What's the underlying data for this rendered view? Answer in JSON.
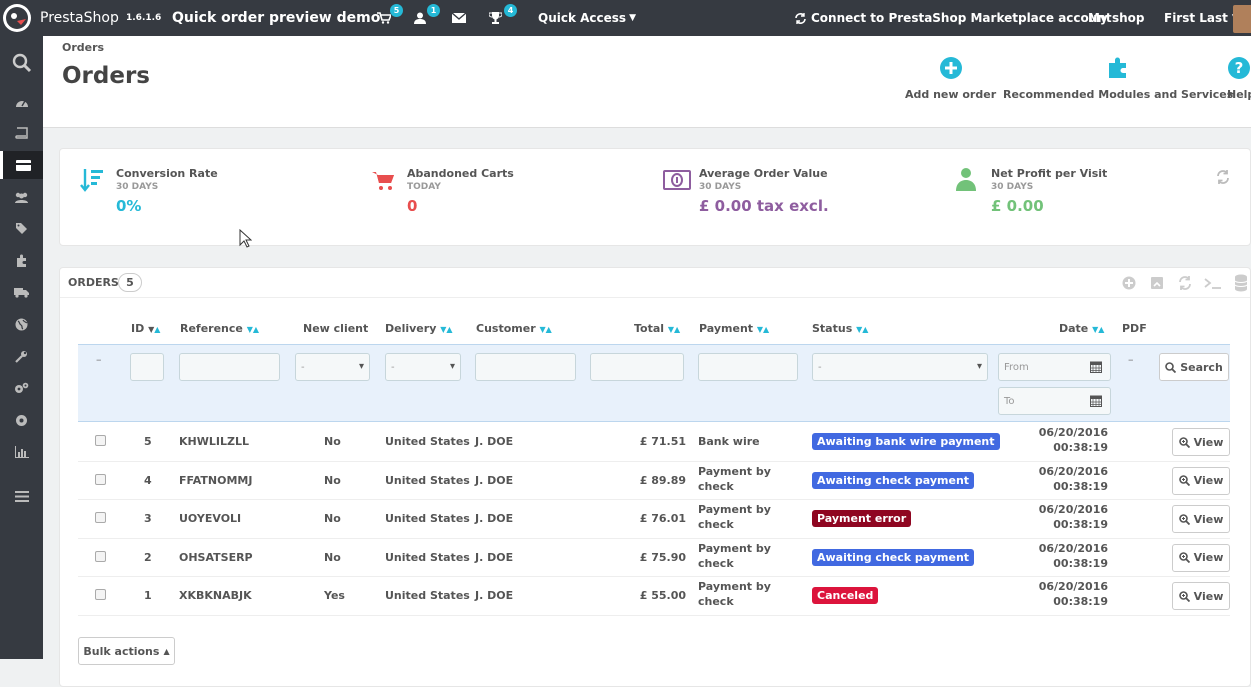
{
  "topbar": {
    "brand": "PrestaShop",
    "version": "1.6.1.6",
    "store_name": "Quick order preview demo",
    "cart_count": "5",
    "customer_count": "1",
    "trophy_count": "4",
    "quick_access": "Quick Access",
    "marketplace": "Connect to PrestaShop Marketplace account",
    "my_shop": "My shop",
    "user": "First Last"
  },
  "header": {
    "breadcrumb": "Orders",
    "title": "Orders",
    "toolbar": {
      "add_new": "Add new order",
      "recommended": "Recommended Modules and Services",
      "help": "Help"
    }
  },
  "kpis": [
    {
      "title": "Conversion Rate",
      "sub": "30 DAYS",
      "value": "0%",
      "color": "#25b9d7",
      "icon": "sort-arrow-icon"
    },
    {
      "title": "Abandoned Carts",
      "sub": "TODAY",
      "value": "0",
      "color": "#e84e4e",
      "icon": "cart-icon"
    },
    {
      "title": "Average Order Value",
      "sub": "30 DAYS",
      "value": "£ 0.00 tax excl.",
      "color": "#8e5d9f",
      "icon": "money-icon"
    },
    {
      "title": "Net Profit per Visit",
      "sub": "30 DAYS",
      "value": "£ 0.00",
      "color": "#72c279",
      "icon": "user-icon"
    }
  ],
  "orders": {
    "heading": "ORDERS",
    "count": "5",
    "columns": {
      "id": "ID",
      "reference": "Reference",
      "new_client": "New client",
      "delivery": "Delivery",
      "customer": "Customer",
      "total": "Total",
      "payment": "Payment",
      "status": "Status",
      "date": "Date",
      "pdf": "PDF"
    },
    "filters": {
      "new_client": "-",
      "delivery": "-",
      "status": "-",
      "dash": "–",
      "pdf_dash": "–",
      "from": "From",
      "to": "To",
      "search": "Search"
    },
    "rows": [
      {
        "id": "5",
        "ref": "KHWLILZLL",
        "new": "No",
        "delivery": "United States",
        "customer": "J. DOE",
        "total": "£ 71.51",
        "pay1": "Bank wire",
        "pay2": "",
        "status": "Awaiting bank wire payment",
        "status_color": "#4169e1",
        "date": "06/20/2016",
        "time": "00:38:19",
        "view": "View"
      },
      {
        "id": "4",
        "ref": "FFATNOMMJ",
        "new": "No",
        "delivery": "United States",
        "customer": "J. DOE",
        "total": "£ 89.89",
        "pay1": "Payment by",
        "pay2": "check",
        "status": "Awaiting check payment",
        "status_color": "#4169e1",
        "date": "06/20/2016",
        "time": "00:38:19",
        "view": "View"
      },
      {
        "id": "3",
        "ref": "UOYEVOLI",
        "new": "No",
        "delivery": "United States",
        "customer": "J. DOE",
        "total": "£ 76.01",
        "pay1": "Payment by",
        "pay2": "check",
        "status": "Payment error",
        "status_color": "#8f0621",
        "date": "06/20/2016",
        "time": "00:38:19",
        "view": "View"
      },
      {
        "id": "2",
        "ref": "OHSATSERP",
        "new": "No",
        "delivery": "United States",
        "customer": "J. DOE",
        "total": "£ 75.90",
        "pay1": "Payment by",
        "pay2": "check",
        "status": "Awaiting check payment",
        "status_color": "#4169e1",
        "date": "06/20/2016",
        "time": "00:38:19",
        "view": "View"
      },
      {
        "id": "1",
        "ref": "XKBKNABJK",
        "new": "Yes",
        "delivery": "United States",
        "customer": "J. DOE",
        "total": "£ 55.00",
        "pay1": "Payment by",
        "pay2": "check",
        "status": "Canceled",
        "status_color": "#dc143c",
        "date": "06/20/2016",
        "time": "00:38:19",
        "view": "View"
      }
    ],
    "bulk": "Bulk actions"
  }
}
